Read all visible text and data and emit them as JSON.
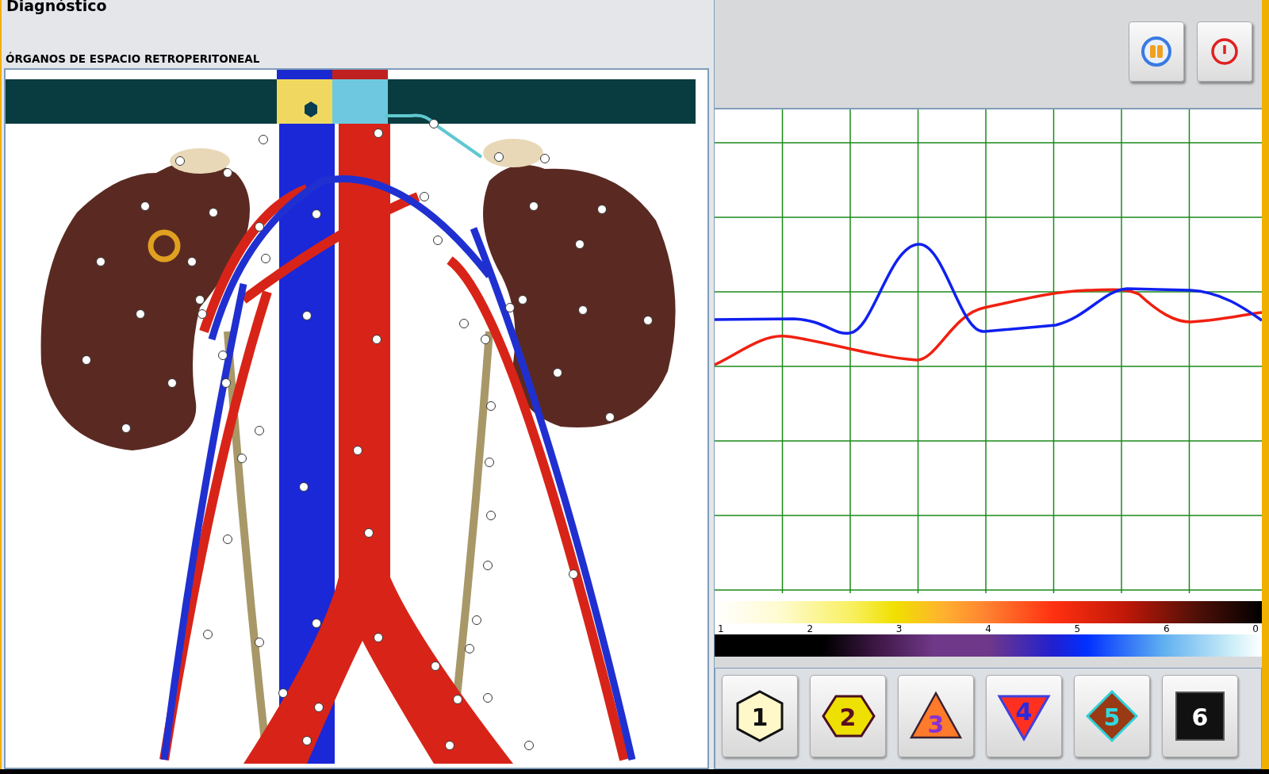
{
  "window": {
    "title": "Diagnóstico"
  },
  "section": {
    "title": "ÓRGANOS DE ESPACIO RETROPERITONEAL"
  },
  "scale": {
    "labels": [
      "1",
      "2",
      "3",
      "4",
      "5",
      "6",
      "0"
    ]
  },
  "symbols": [
    {
      "label": "1",
      "kind": "hexagon"
    },
    {
      "label": "2",
      "kind": "hexagon-wide"
    },
    {
      "label": "3",
      "kind": "triangle"
    },
    {
      "label": "4",
      "kind": "triangle-down"
    },
    {
      "label": "5",
      "kind": "diamond"
    },
    {
      "label": "6",
      "kind": "square"
    }
  ]
}
